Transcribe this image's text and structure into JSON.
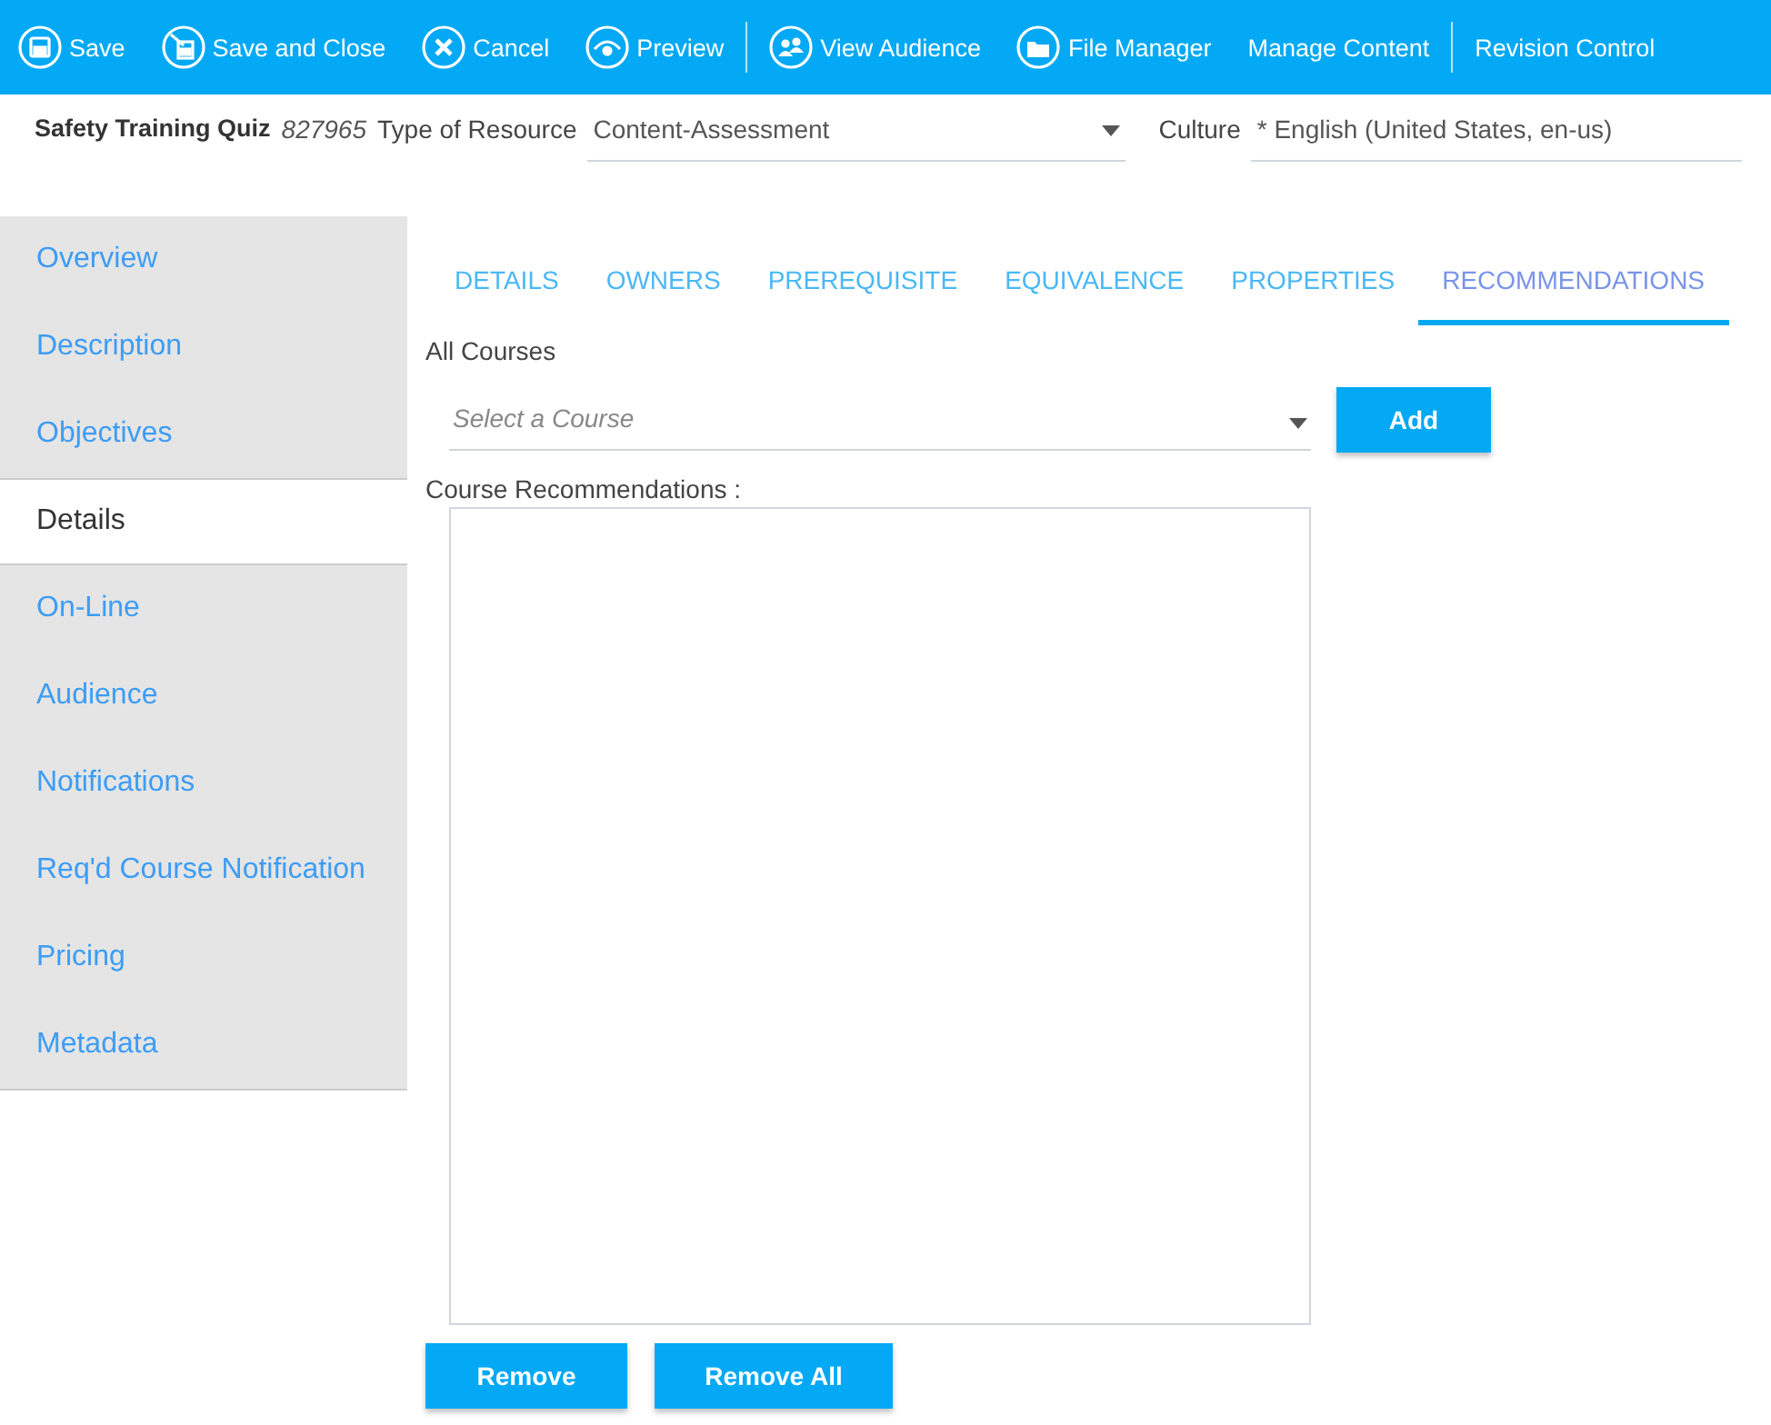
{
  "toolbar": [
    {
      "kind": "button",
      "label": "Save"
    },
    {
      "kind": "button",
      "label": "Save and Close"
    },
    {
      "kind": "button",
      "label": "Cancel"
    },
    {
      "kind": "button",
      "label": "Preview"
    },
    {
      "kind": "separator"
    },
    {
      "kind": "button",
      "label": "View Audience"
    },
    {
      "kind": "button",
      "label": "File Manager"
    },
    {
      "kind": "button",
      "label": "Manage Content"
    },
    {
      "kind": "separator"
    },
    {
      "kind": "button",
      "label": "Revision Control"
    }
  ],
  "header": {
    "title": "Safety Training Quiz",
    "id": "827965",
    "type_label": "Type of Resource",
    "type_value": "Content-Assessment",
    "culture_label": "Culture",
    "culture_value": "* English (United States, en-us)"
  },
  "sidebar": [
    {
      "label": "Overview",
      "selected": false
    },
    {
      "label": "Description",
      "selected": false
    },
    {
      "label": "Objectives",
      "selected": false
    },
    {
      "label": "Details",
      "selected": true
    },
    {
      "label": "On-Line",
      "selected": false
    },
    {
      "label": "Audience",
      "selected": false
    },
    {
      "label": "Notifications",
      "selected": false
    },
    {
      "label": "Req'd Course Notification",
      "selected": false
    },
    {
      "label": "Pricing",
      "selected": false
    },
    {
      "label": "Metadata",
      "selected": false
    }
  ],
  "tabs": [
    {
      "label": "DETAILS",
      "selected": false
    },
    {
      "label": "OWNERS",
      "selected": false
    },
    {
      "label": "PREREQUISITE",
      "selected": false
    },
    {
      "label": "EQUIVALENCE",
      "selected": false
    },
    {
      "label": "PROPERTIES",
      "selected": false
    },
    {
      "label": "RECOMMENDATIONS",
      "selected": true
    }
  ],
  "all_courses_label": "All Courses",
  "course_select": {
    "placeholder": "Select a Course"
  },
  "add_button": "Add",
  "recommendations_label": "Course Recommendations :",
  "buttons": [
    "Remove",
    "Remove All"
  ]
}
